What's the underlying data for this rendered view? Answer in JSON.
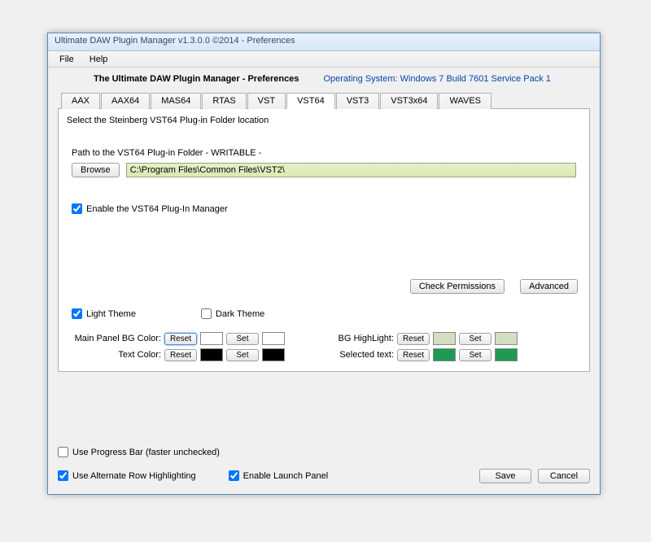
{
  "window": {
    "title": "Ultimate DAW Plugin Manager  v1.3.0.0  ©2014 -   Preferences"
  },
  "menu": {
    "file": "File",
    "help": "Help"
  },
  "header": {
    "title": "The Ultimate DAW Plugin Manager - Preferences",
    "os_label": "Operating System: Windows 7 Build 7601 Service Pack 1"
  },
  "tabs": [
    "AAX",
    "AAX64",
    "MAS64",
    "RTAS",
    "VST",
    "VST64",
    "VST3",
    "VST3x64",
    "WAVES"
  ],
  "active_tab_index": 5,
  "tab_content": {
    "instruction": "Select the Steinberg VST64 Plug-in Folder location",
    "path_label": "Path to the VST64 Plug-in Folder - WRITABLE -",
    "browse": "Browse",
    "path_value": "C:\\Program Files\\Common Files\\VST2\\",
    "enable_mgr": "Enable the VST64 Plug-In Manager",
    "enable_mgr_checked": true,
    "check_perms": "Check Permissions",
    "advanced": "Advanced",
    "light_theme": "Light Theme",
    "light_theme_checked": true,
    "dark_theme": "Dark Theme",
    "dark_theme_checked": false,
    "colors": {
      "main_bg_label": "Main Panel BG Color:",
      "text_color_label": "Text Color:",
      "bg_highlight_label": "BG HighLight:",
      "selected_text_label": "Selected text:",
      "reset": "Reset",
      "set": "Set",
      "main_bg_reset_sw": "#ffffff",
      "main_bg_set_sw": "#ffffff",
      "text_reset_sw": "#000000",
      "text_set_sw": "#000000",
      "bghl_reset_sw": "#d2dfc0",
      "bghl_set_sw": "#d2dfc0",
      "sel_reset_sw": "#1f9a55",
      "sel_set_sw": "#1f9a55"
    }
  },
  "footer": {
    "progress_bar": "Use Progress Bar (faster unchecked)",
    "progress_bar_checked": false,
    "alt_row": "Use Alternate Row Highlighting",
    "alt_row_checked": true,
    "launch_panel": "Enable Launch Panel",
    "launch_panel_checked": true,
    "save": "Save",
    "cancel": "Cancel"
  }
}
